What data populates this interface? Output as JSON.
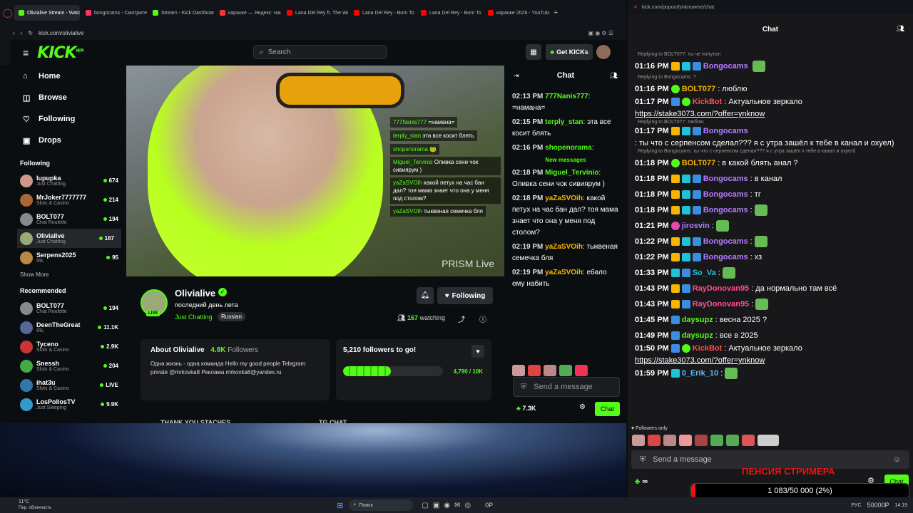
{
  "browser": {
    "tabs": [
      {
        "label": "Olivialive Stream - Watc",
        "color": "#53fc18",
        "active": true
      },
      {
        "label": "bongocams - Смотрите с",
        "color": "#f36"
      },
      {
        "label": "Stream - Kick Dashboard",
        "color": "#53fc18"
      },
      {
        "label": "караоке — Яндекс: нашл",
        "color": "#f33"
      },
      {
        "label": "Lana Del Rey ft. The Week",
        "color": "#f00"
      },
      {
        "label": "Lana Del Rey - Born To Di",
        "color": "#f00"
      },
      {
        "label": "Lana Del Rey - Born To Di",
        "color": "#f00"
      },
      {
        "label": "караоке 2026 - YouTube",
        "color": "#f00"
      }
    ],
    "url": "kick.com/olivialive",
    "popout_url": "kick.com/popout/ynknowme/chat"
  },
  "kick": {
    "logo": "KICK",
    "logo_beta": "BETA",
    "search_placeholder": "Search",
    "get_kicks": "Get KICKs"
  },
  "sidebar": {
    "nav": [
      {
        "label": "Home",
        "icon": "home-icon",
        "glyph": "⌂"
      },
      {
        "label": "Browse",
        "icon": "browse-icon",
        "glyph": "◫"
      },
      {
        "label": "Following",
        "icon": "heart-icon",
        "glyph": "♡"
      },
      {
        "label": "Drops",
        "icon": "drops-icon",
        "glyph": "▣"
      }
    ],
    "following_title": "Following",
    "following": [
      {
        "name": "lupupka",
        "cat": "Just Chatting",
        "viewers": "674",
        "color": "#c98"
      },
      {
        "name": "MrJoker7777777",
        "cat": "Slots & Casino",
        "viewers": "214",
        "color": "#a63"
      },
      {
        "name": "BOLT077",
        "cat": "Chat Roulette",
        "viewers": "194",
        "color": "#888"
      },
      {
        "name": "Olivialive",
        "cat": "Just Chatting",
        "viewers": "167",
        "color": "#9a7",
        "selected": true
      },
      {
        "name": "Serpens2025",
        "cat": "IRL",
        "viewers": "95",
        "color": "#b84"
      }
    ],
    "show_more": "Show More",
    "recommended_title": "Recommended",
    "recommended": [
      {
        "name": "BOLT077",
        "cat": "Chat Roulette",
        "viewers": "194",
        "color": "#888"
      },
      {
        "name": "DeenTheGreat",
        "cat": "IRL",
        "viewers": "11.1K",
        "color": "#569"
      },
      {
        "name": "Tyceno",
        "cat": "Slots & Casino",
        "viewers": "2.9K",
        "color": "#c33"
      },
      {
        "name": "Snessh",
        "cat": "Slots & Casino",
        "viewers": "204",
        "color": "#4a4"
      },
      {
        "name": "ihat3u",
        "cat": "Slots & Casino",
        "viewers": "LIVE",
        "color": "#37a"
      },
      {
        "name": "LosPollosTV",
        "cat": "Just Sleeping",
        "viewers": "9.9K",
        "color": "#39c"
      }
    ]
  },
  "video": {
    "watermark": "PRISM Live",
    "overlay_chat": [
      {
        "user": "777Nanis777",
        "text": "=намана="
      },
      {
        "user": "terply_stan",
        "text": "эта все косит блять"
      },
      {
        "user": "shopenorama",
        "text": "🐸"
      },
      {
        "user": "Miguel_Tervinio",
        "text": "Оливка сени чок сивиярум )"
      },
      {
        "user": "yaZaSVOih",
        "text": "какой петух на час бан дал? тоя мама знает что она у меня под столом?"
      },
      {
        "user": "yaZaSVOih",
        "text": "тыквеная семечка бля"
      }
    ]
  },
  "channel": {
    "name": "Olivialive",
    "title": "последний день лета",
    "category": "Just Chatting",
    "tag": "Russian",
    "live": "LIVE",
    "following_btn": "Following",
    "watching": "167",
    "watching_label": "watching",
    "about_title": "About Olivialive",
    "followers_count": "4.8K",
    "followers_label": "Followers",
    "about_text": "Одна жизнь - одна команда Hello my good people Telegram private @mrkovka8 Реклама mrkovka8@yandex.ru",
    "goal_title": "5,210 followers to go!",
    "goal_progress": "4,790 / 10K",
    "goal_fraction": 0.479,
    "thanks": "THANK YOU STACHES",
    "tg_chat": "TG CHAT"
  },
  "chat1": {
    "title": "Chat",
    "messages": [
      {
        "time": "02:13 PM",
        "user": "777Nanis777",
        "text": "=намана=",
        "color": "#53fc18"
      },
      {
        "time": "02:15 PM",
        "user": "terply_stan",
        "text": "эта все косит блять",
        "color": "#53fc18"
      },
      {
        "time": "02:16 PM",
        "user": "shopenorama",
        "text": "",
        "color": "#53fc18"
      },
      {
        "time": "02:18 PM",
        "user": "Miguel_Tervinio",
        "text": "Оливка сени чок сивиярум )",
        "color": "#53fc18"
      },
      {
        "time": "02:18 PM",
        "user": "yaZaSVOih",
        "text": "какой петух на час бан дал? тоя мама знает что она у меня под столом?",
        "color": "#f7b500"
      },
      {
        "time": "02:19 PM",
        "user": "yaZaSVOih",
        "text": "тыквеная семечка бля",
        "color": "#f7b500"
      },
      {
        "time": "02:19 PM",
        "user": "yaZaSVOih",
        "text": "ебало ему набить",
        "color": "#f7b500"
      }
    ],
    "new_messages": "New messages",
    "input_placeholder": "Send a message",
    "kicks": "7.3K",
    "chat_btn": "Chat"
  },
  "popout": {
    "title": "Chat",
    "messages": [
      {
        "reply": "Replying to BOLT077: ты че попутал"
      },
      {
        "time": "01:16 PM",
        "user": "Bongocams",
        "color": "#b57cff",
        "text": "",
        "badges": [
          "crown",
          "sub",
          "blue"
        ]
      },
      {
        "reply": "Replying to Bongocams: ?"
      },
      {
        "time": "01:16 PM",
        "user": "BOLT077",
        "color": "#f7b500",
        "text": ": люблю",
        "badges": [
          "green"
        ]
      },
      {
        "time": "01:17 PM",
        "user": "KickBot",
        "color": "#ff4d4d",
        "text": ": Актуальное зеркало ",
        "link": "https://stake3073.com/?offer=ynknow",
        "badges": [
          "blue",
          "green"
        ]
      },
      {
        "reply": "Replying to BOLT077: люблю"
      },
      {
        "time": "01:17 PM",
        "user": "Bongocams",
        "color": "#b57cff",
        "text": ": ты что с серпенсом сделал??? я с утра зашёл к тебе в канал и охуел)",
        "badges": [
          "crown",
          "sub",
          "blue"
        ]
      },
      {
        "reply": "Replying to Bongocams: ты что с серпенсом сделал??? я с утра зашёл к тебе в канал и охуел)"
      },
      {
        "time": "01:18 PM",
        "user": "BOLT077",
        "color": "#f7b500",
        "text": ": в какой блять анал ?",
        "badges": [
          "green"
        ]
      },
      {
        "time": "01:18 PM",
        "user": "Bongocams",
        "color": "#b57cff",
        "text": ": в канал",
        "badges": [
          "crown",
          "sub",
          "blue"
        ]
      },
      {
        "time": "01:18 PM",
        "user": "Bongocams",
        "color": "#b57cff",
        "text": ": тг",
        "badges": [
          "crown",
          "sub",
          "blue"
        ]
      },
      {
        "time": "01:18 PM",
        "user": "Bongocams",
        "color": "#b57cff",
        "text": ":",
        "badges": [
          "crown",
          "sub",
          "blue"
        ]
      },
      {
        "time": "01:21 PM",
        "user": "jirosvin",
        "color": "#b57cff",
        "text": ":",
        "badges": [
          "pink"
        ]
      },
      {
        "time": "01:22 PM",
        "user": "Bongocams",
        "color": "#b57cff",
        "text": ":",
        "badges": [
          "crown",
          "sub",
          "blue"
        ]
      },
      {
        "time": "01:22 PM",
        "user": "Bongocams",
        "color": "#b57cff",
        "text": ": хз",
        "badges": [
          "crown",
          "sub",
          "blue"
        ]
      },
      {
        "time": "01:33 PM",
        "user": "So_Va",
        "color": "#1ec2d9",
        "text": ":",
        "badges": [
          "sub",
          "blue"
        ]
      },
      {
        "time": "01:43 PM",
        "user": "RayDonovan95",
        "color": "#ff4d8d",
        "text": ": да нормально там всё",
        "badges": [
          "crown",
          "blue"
        ]
      },
      {
        "time": "01:43 PM",
        "user": "RayDonovan95",
        "color": "#ff4d8d",
        "text": ":",
        "badges": [
          "crown",
          "blue"
        ]
      },
      {
        "time": "01:45 PM",
        "user": "daysupz",
        "color": "#53fc18",
        "text": ": весна 2025 ?",
        "badges": [
          "blue"
        ]
      },
      {
        "time": "01:49 PM",
        "user": "daysupz",
        "color": "#53fc18",
        "text": ": все в 2025",
        "badges": [
          "blue"
        ]
      },
      {
        "time": "01:50 PM",
        "user": "KickBot",
        "color": "#ff4d4d",
        "text": ": Актуальное зеркало ",
        "link": "https://stake3073.com/?offer=ynknow",
        "badges": [
          "blue",
          "green"
        ]
      },
      {
        "time": "01:59 PM",
        "user": "0_Erik_10",
        "color": "#5ab8ff",
        "text": ":",
        "badges": [
          "sub"
        ]
      }
    ],
    "followers_only": "Followers only",
    "input_placeholder": "Send a message",
    "pension": "ПЕНСИЯ СТРИМЕРА",
    "goal": "1 083/50 000 (2%)",
    "goal_fraction": 0.02,
    "chat_btn": "Chat",
    "kicks": "∞"
  },
  "taskbar": {
    "weather": "11°C",
    "weather_sub": "Пер. облачность",
    "search": "Поиск",
    "lang": "РУС",
    "time": "14:19",
    "op": "0P",
    "num": "50000P"
  }
}
